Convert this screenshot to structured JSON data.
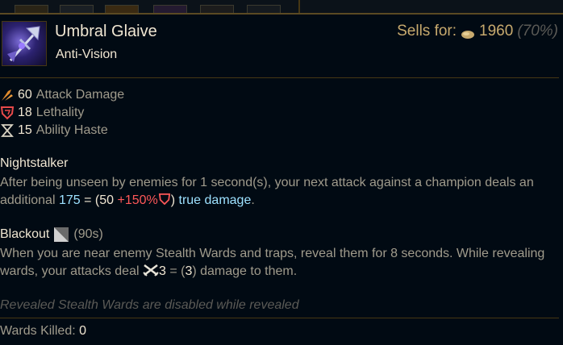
{
  "item": {
    "name": "Umbral Glaive",
    "subtitle": "Anti-Vision",
    "icon": "glaive-item-icon"
  },
  "sell": {
    "label": "Sells for:",
    "value": "1960",
    "percent": "(70%)",
    "icon": "gold-coin-icon"
  },
  "stats": [
    {
      "icon": "attack-damage-icon",
      "value": "60",
      "name": "Attack Damage"
    },
    {
      "icon": "lethality-icon",
      "value": "18",
      "name": "Lethality"
    },
    {
      "icon": "ability-haste-icon",
      "value": "15",
      "name": "Ability Haste"
    }
  ],
  "passive1": {
    "title": "Nightstalker",
    "text_a": "After being unseen by enemies for 1 second(s), your next attack against a champion deals an additional ",
    "value": "175",
    "eq": " = (50 ",
    "scaling": "+150%",
    "close": ")",
    "dmg": " true damage",
    "period": "."
  },
  "passive2": {
    "title": "Blackout",
    "cooldown": "(90s)",
    "text_a": "When you are near enemy Stealth Wards and traps, reveal them for 8 seconds. While revealing wards, your attacks deal ",
    "val": "3",
    "eq": " = (",
    "val2": "3",
    "text_b": ") damage to them."
  },
  "note": "Revealed Stealth Wards are disabled while revealed",
  "wards": {
    "label": "Wards Killed:",
    "value": "0"
  },
  "colors": {
    "gold": "#c8aa6e",
    "border": "#463714",
    "bg": "#010a13",
    "true_damage": "#9de1ff",
    "scaling": "#ff5859"
  }
}
